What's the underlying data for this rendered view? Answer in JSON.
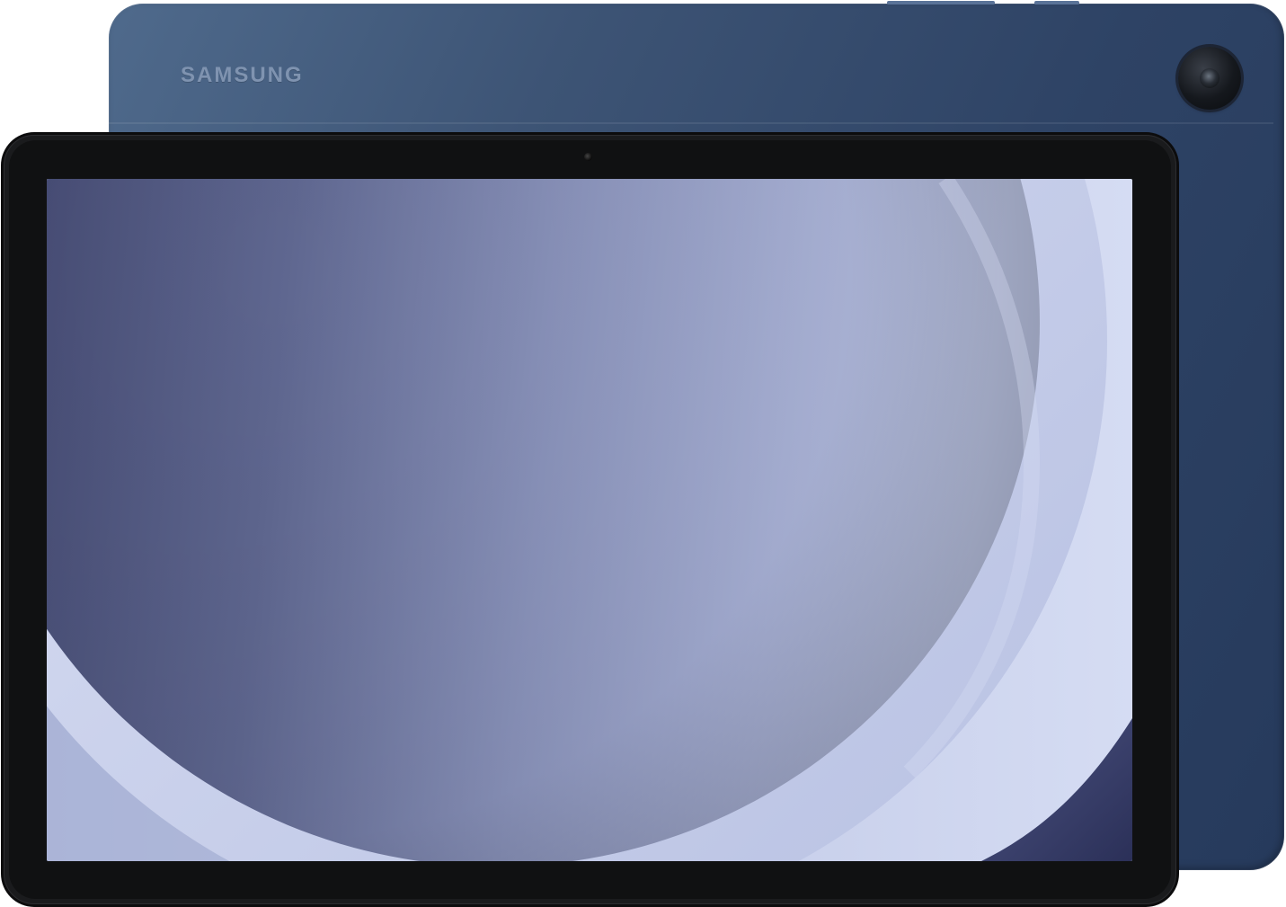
{
  "image": {
    "subject": "tablet"
  },
  "device": {
    "brand_logo": "SAMSUNG",
    "colors": {
      "back_panel": "#34496b",
      "bezel": "#1a1b1d",
      "wallpaper_shadow": "#3f4670",
      "wallpaper_light": "#c3cbea"
    },
    "icons": [
      "rear-camera-icon",
      "front-camera-icon"
    ]
  }
}
